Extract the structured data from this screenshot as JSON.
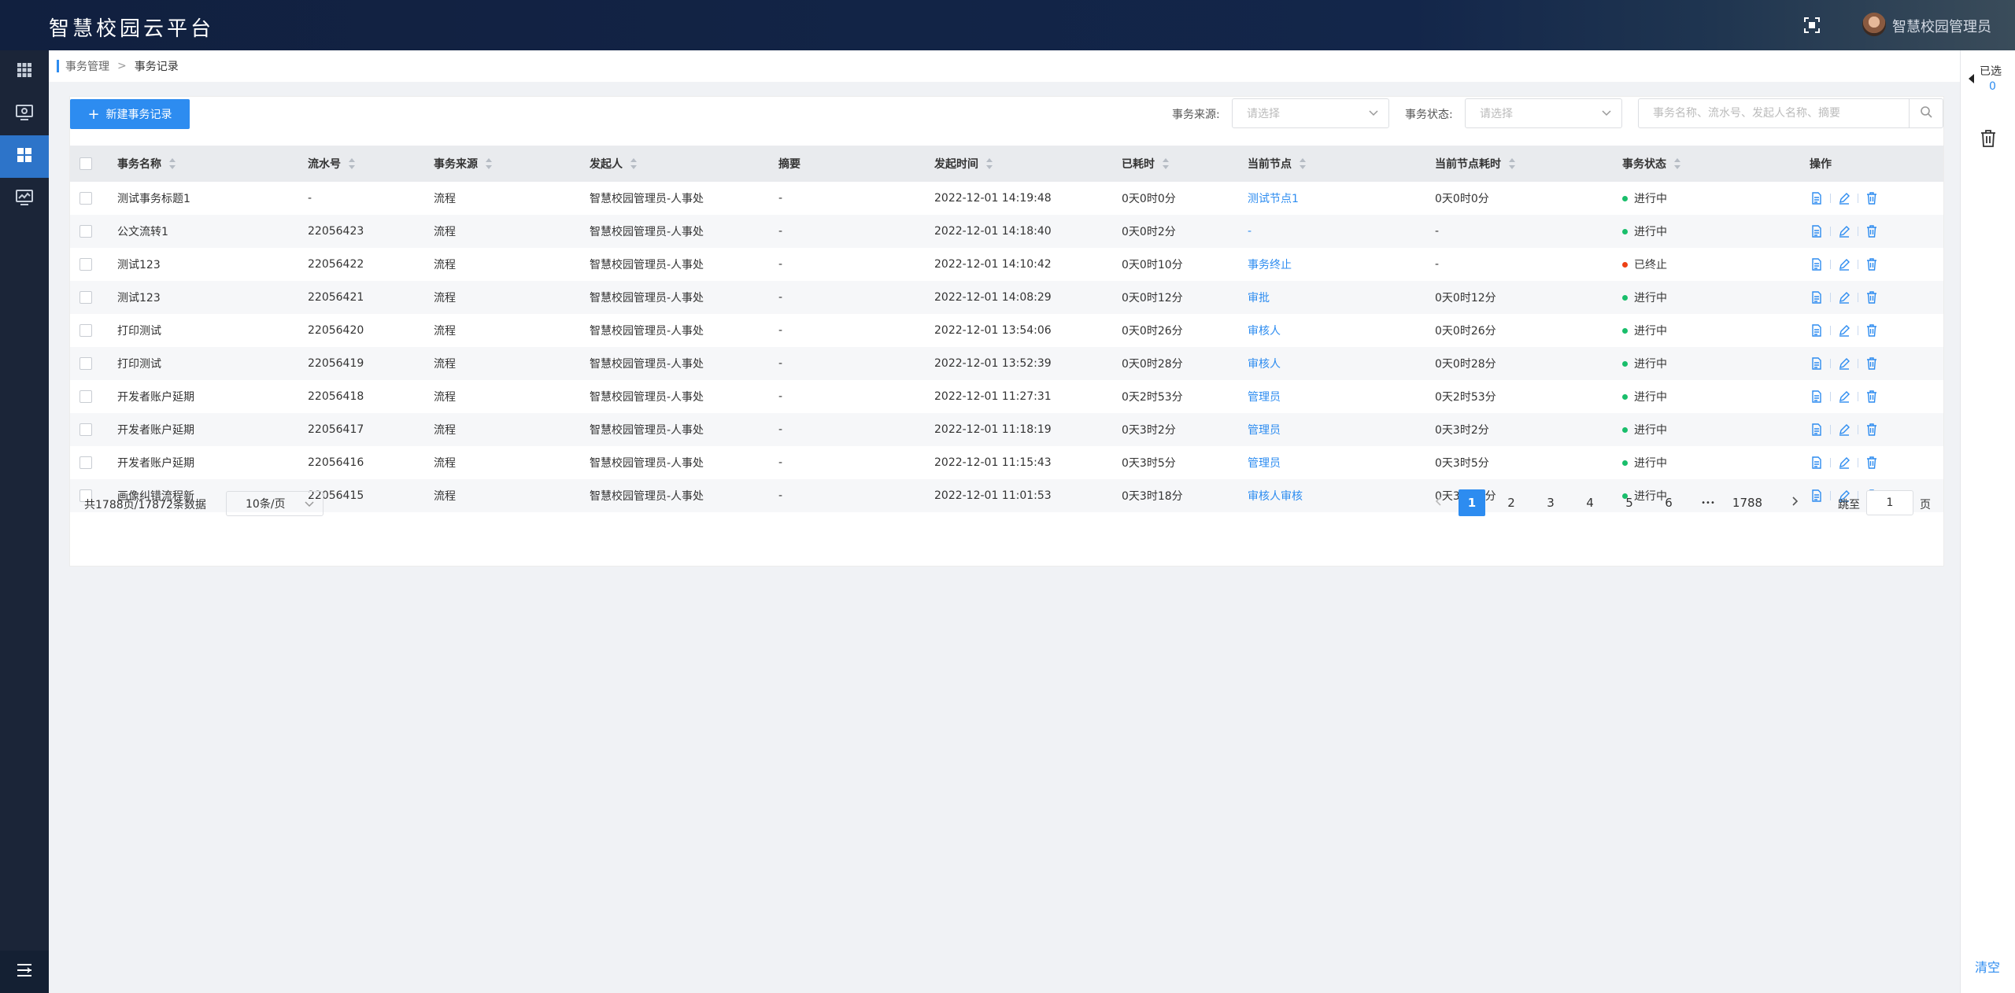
{
  "header": {
    "title": "智慧校园云平台",
    "user_name": "智慧校园管理员"
  },
  "sidebar": {
    "items": [
      {
        "icon": "apps-grid-icon"
      },
      {
        "icon": "monitor-icon"
      },
      {
        "icon": "dashboard-icon",
        "active": true
      },
      {
        "icon": "screen-chart-icon"
      }
    ],
    "bottom_icon": "menu-toggle-icon"
  },
  "breadcrumb": {
    "parent": "事务管理",
    "separator": ">",
    "current": "事务记录"
  },
  "toolbar": {
    "new_button": "新建事务记录",
    "source_label": "事务来源:",
    "source_placeholder": "请选择",
    "status_label": "事务状态:",
    "status_placeholder": "请选择",
    "search_placeholder": "事务名称、流水号、发起人名称、摘要"
  },
  "table": {
    "columns": [
      "事务名称",
      "流水号",
      "事务来源",
      "发起人",
      "摘要",
      "发起时间",
      "已耗时",
      "当前节点",
      "当前节点耗时",
      "事务状态",
      "操作"
    ],
    "rows": [
      {
        "name": "测试事务标题1",
        "serial": "-",
        "source": "流程",
        "initiator": "智慧校园管理员-人事处",
        "summary": "-",
        "time": "2022-12-01 14:19:48",
        "elapsed": "0天0时0分",
        "node": "测试节点1",
        "node_elapsed": "0天0时0分",
        "status": "进行中",
        "status_color": "#19be6b"
      },
      {
        "name": "公文流转1",
        "serial": "22056423",
        "source": "流程",
        "initiator": "智慧校园管理员-人事处",
        "summary": "-",
        "time": "2022-12-01 14:18:40",
        "elapsed": "0天0时2分",
        "node": "-",
        "node_elapsed": "-",
        "status": "进行中",
        "status_color": "#19be6b"
      },
      {
        "name": "测试123",
        "serial": "22056422",
        "source": "流程",
        "initiator": "智慧校园管理员-人事处",
        "summary": "-",
        "time": "2022-12-01 14:10:42",
        "elapsed": "0天0时10分",
        "node": "事务终止",
        "node_elapsed": "-",
        "status": "已终止",
        "status_color": "#ed4014"
      },
      {
        "name": "测试123",
        "serial": "22056421",
        "source": "流程",
        "initiator": "智慧校园管理员-人事处",
        "summary": "-",
        "time": "2022-12-01 14:08:29",
        "elapsed": "0天0时12分",
        "node": "审批",
        "node_elapsed": "0天0时12分",
        "status": "进行中",
        "status_color": "#19be6b"
      },
      {
        "name": "打印测试",
        "serial": "22056420",
        "source": "流程",
        "initiator": "智慧校园管理员-人事处",
        "summary": "-",
        "time": "2022-12-01 13:54:06",
        "elapsed": "0天0时26分",
        "node": "审核人",
        "node_elapsed": "0天0时26分",
        "status": "进行中",
        "status_color": "#19be6b"
      },
      {
        "name": "打印测试",
        "serial": "22056419",
        "source": "流程",
        "initiator": "智慧校园管理员-人事处",
        "summary": "-",
        "time": "2022-12-01 13:52:39",
        "elapsed": "0天0时28分",
        "node": "审核人",
        "node_elapsed": "0天0时28分",
        "status": "进行中",
        "status_color": "#19be6b"
      },
      {
        "name": "开发者账户延期",
        "serial": "22056418",
        "source": "流程",
        "initiator": "智慧校园管理员-人事处",
        "summary": "-",
        "time": "2022-12-01 11:27:31",
        "elapsed": "0天2时53分",
        "node": "管理员",
        "node_elapsed": "0天2时53分",
        "status": "进行中",
        "status_color": "#19be6b"
      },
      {
        "name": "开发者账户延期",
        "serial": "22056417",
        "source": "流程",
        "initiator": "智慧校园管理员-人事处",
        "summary": "-",
        "time": "2022-12-01 11:18:19",
        "elapsed": "0天3时2分",
        "node": "管理员",
        "node_elapsed": "0天3时2分",
        "status": "进行中",
        "status_color": "#19be6b"
      },
      {
        "name": "开发者账户延期",
        "serial": "22056416",
        "source": "流程",
        "initiator": "智慧校园管理员-人事处",
        "summary": "-",
        "time": "2022-12-01 11:15:43",
        "elapsed": "0天3时5分",
        "node": "管理员",
        "node_elapsed": "0天3时5分",
        "status": "进行中",
        "status_color": "#19be6b"
      },
      {
        "name": "画像纠错流程新",
        "serial": "22056415",
        "source": "流程",
        "initiator": "智慧校园管理员-人事处",
        "summary": "-",
        "time": "2022-12-01 11:01:53",
        "elapsed": "0天3时18分",
        "node": "审核人审核",
        "node_elapsed": "0天3时18分",
        "status": "进行中",
        "status_color": "#19be6b"
      }
    ]
  },
  "pagination": {
    "total_text": "共1788页/17872条数据",
    "page_size": "10条/页",
    "pages": [
      "1",
      "2",
      "3",
      "4",
      "5",
      "6",
      "•••",
      "1788"
    ],
    "current": "1",
    "goto_label": "跳至",
    "goto_value": "1",
    "goto_suffix": "页"
  },
  "right_panel": {
    "selected_label": "已选",
    "selected_count": "0",
    "clear_label": "清空"
  },
  "colors": {
    "primary": "#2d8cf0",
    "running": "#19be6b",
    "stopped": "#ed4014",
    "header_bg": "#13264a",
    "rail_bg": "#1b2538"
  }
}
